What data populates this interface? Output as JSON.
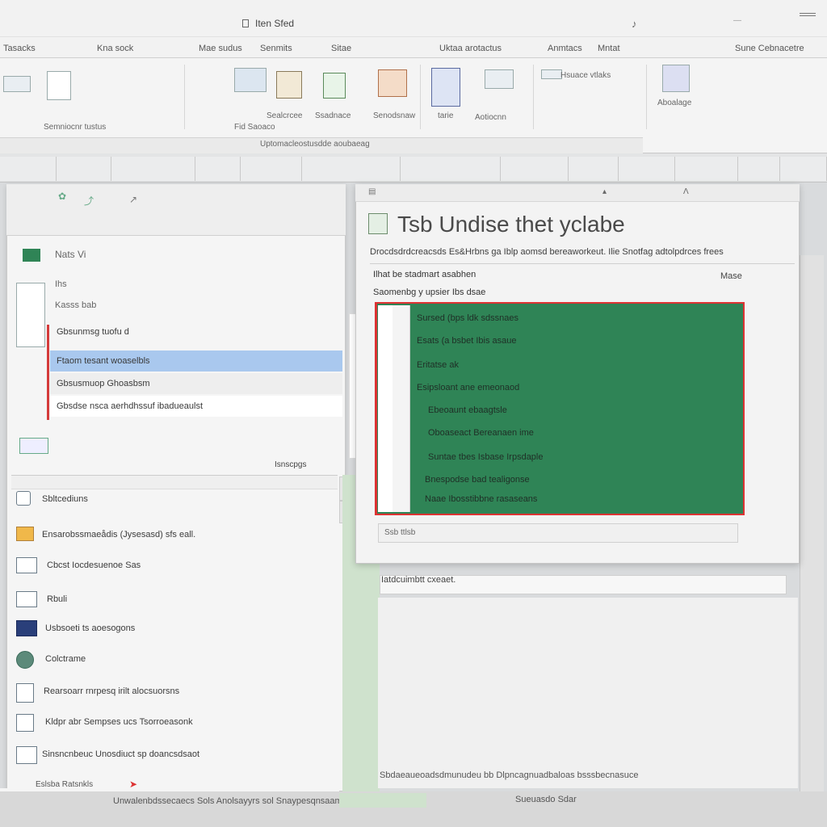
{
  "title_bar": {
    "app_title": "Iten Sfed",
    "min_glyph": "—"
  },
  "ribbon_tabs": [
    "Tasacks",
    "Kna sock",
    "Mae sudus",
    "Senmits",
    "Sitae",
    "Uktaa arotactus",
    "Anmtacs",
    "Mntat",
    "Sune Cebnacetre"
  ],
  "ribbon_groups": [
    {
      "label": "Semniocnr tustus"
    },
    {
      "label": "Fid Saoaco"
    },
    {
      "label": "Sealcrcee"
    },
    {
      "label": "Ssadnace"
    },
    {
      "label": "Senodsnaw"
    },
    {
      "label": "tarie"
    },
    {
      "label": "Aotiocnn"
    },
    {
      "label": "Hsuace vtlaks"
    },
    {
      "label": "Aboalage"
    }
  ],
  "ribbon_status": "Uptomacleostusdde aoubaeag",
  "left_dialog": {
    "header_label": "Nats Vi",
    "sub_label_1": "Ihs",
    "sub_label_2": "Kasss bab",
    "rows": [
      "Gbsunmsg tuofu d",
      "Ftaom tesant woaselbls",
      "Gbsusmuop Ghoasbsm",
      "Gbsdse nsca aerhdhssuf ibadueaulst"
    ],
    "dropdown_label": "Isnscpgs",
    "options": [
      {
        "icon": "list-icon",
        "label": "Sbltcediuns"
      },
      {
        "icon": "folder-icon",
        "label": "Ensarobssmaeådis (Jysesasd) sfs eall."
      },
      {
        "icon": "table-icon",
        "label": "Cbcst Iocdesuenoe Sas"
      },
      {
        "icon": "doc-icon",
        "label": "Rbuli"
      },
      {
        "icon": "chart-icon",
        "label": "Usbsoeti ts aoesogons"
      },
      {
        "icon": "globe-icon",
        "label": "Colctrame"
      },
      {
        "icon": "doc-icon",
        "label": "Rearsoarr rnrpesq irilt alocsuorsns"
      },
      {
        "icon": "image-icon",
        "label": "Kldpr abr Sempses ucs Tsorroeasonk"
      },
      {
        "icon": "doc-icon",
        "label": "Sinsncnbeuc Unosdiuct sp doancsdsaot"
      }
    ]
  },
  "right_dialog": {
    "title": "Tsb Undise thet yclabe",
    "description": "Drocdsdrdcreacsds Es&Hrbns ga Iblp aomsd bereaworkeut. Ilie Snotfag adtolpdrces frees",
    "sub_heading": "Ilhat be stadmart asabhen",
    "mode_label": "Mase",
    "preview_label": "Saomenbg y upsier Ibs dsae",
    "green_lines": [
      "Sursed (bps ldk sdssnaes",
      "Esats (a bsbet Ibis asaue",
      "Eritatse ak",
      "Esipsloant ane emeonaod",
      "Ebeoaunt ebaagtsle",
      "Oboaseact Bereanaen ime",
      "Suntae tbes Isbase Irpsdaple",
      "Bnespodse bad tealigonse",
      "Naae Ibosstibbne rasaseans"
    ],
    "footer_label": "Ssb ttlsb",
    "status_text": "Iatdcuimbtt cxeaet."
  },
  "bottom": {
    "left_label": "Eslsba Ratsnkls",
    "center_text": "Unwalenbdssecaecs Sols Anolsayyrs sol Snaypesqnsaam",
    "right_text": "Sueuasdo Sdar",
    "pane_text": "Sbdaeaueoadsdmunudeu bb Dlpncagnuadbaloas bsssbecnasuce"
  },
  "colors": {
    "accent_green": "#2f8456",
    "selection_blue": "#a9c8ee",
    "highlight_red": "#d33333"
  }
}
